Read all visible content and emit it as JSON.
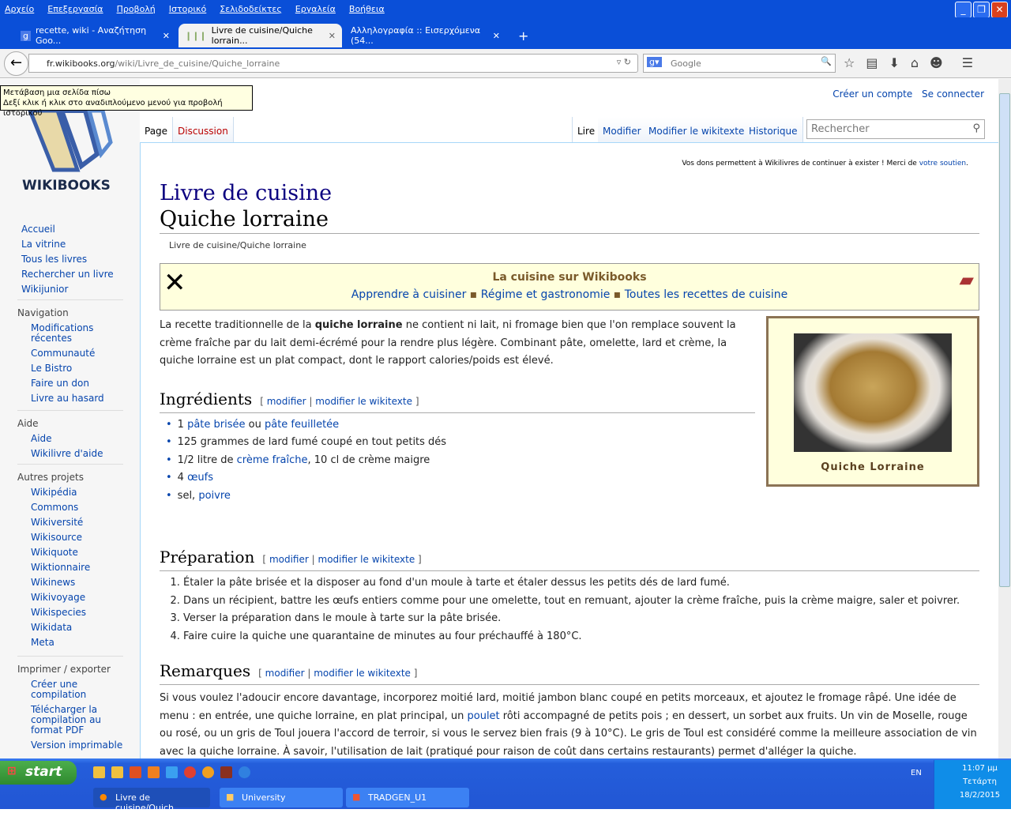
{
  "browser": {
    "menu": [
      "Αρχείο",
      "Επεξεργασία",
      "Προβολή",
      "Ιστορικό",
      "Σελιδοδείκτες",
      "Εργαλεία",
      "Βοήθεια"
    ],
    "tabs": [
      {
        "label": "recette, wiki - Αναζήτηση Goo..."
      },
      {
        "label": "Livre de cuisine/Quiche lorrain..."
      },
      {
        "label": "Αλληλογραφία :: Εισερχόμενα (54..."
      }
    ],
    "url_host": "fr.wikibooks.org",
    "url_path": "/wiki/Livre_de_cuisine/Quiche_lorraine",
    "search_placeholder": "Google",
    "tooltip_line1": "Μετάβαση μια σελίδα πίσω",
    "tooltip_line2": "Δεξί κλικ ή κλικ στο αναδιπλούμενο μενού για προβολή ιστορικού"
  },
  "wiki": {
    "logo_text": "WIKIBOOKS",
    "personal": [
      "Créer un compte",
      "Se connecter"
    ],
    "left_tabs": [
      "Page",
      "Discussion"
    ],
    "right_tabs": [
      "Lire",
      "Modifier",
      "Modifier le wikitexte",
      "Historique"
    ],
    "search_placeholder": "Rechercher",
    "notice_text": "Vos dons permettent à Wikilivres de continuer à exister ! Merci de ",
    "notice_link": "votre soutien",
    "sidebar": {
      "main": [
        "Accueil",
        "La vitrine",
        "Tous les livres",
        "Rechercher un livre",
        "Wikijunior"
      ],
      "navigation_title": "Navigation",
      "navigation": [
        "Modifications récentes",
        "Communauté",
        "Le Bistro",
        "Faire un don",
        "Livre au hasard"
      ],
      "aide_title": "Aide",
      "aide": [
        "Aide",
        "Wikilivre d'aide"
      ],
      "autres_title": "Autres projets",
      "autres": [
        "Wikipédia",
        "Commons",
        "Wikiversité",
        "Wikisource",
        "Wikiquote",
        "Wiktionnaire",
        "Wikinews",
        "Wikivoyage",
        "Wikispecies",
        "Wikidata",
        "Meta"
      ],
      "export_title": "Imprimer / exporter",
      "export": [
        "Créer une compilation",
        "Télécharger la compilation au format PDF",
        "Version imprimable"
      ]
    },
    "title_book": "Livre de cuisine",
    "title_page": "Quiche lorraine",
    "subtitle": "Livre de cuisine/Quiche lorraine",
    "banner": {
      "title": "La cuisine sur Wikibooks",
      "links": [
        "Apprendre à cuisiner",
        "Régime et gastronomie",
        "Toutes les recettes de cuisine"
      ]
    },
    "infobox_caption": "Quiche Lorraine",
    "intro_a": "La recette traditionnelle de la ",
    "intro_b": "quiche lorraine",
    "intro_c": " ne contient ni lait, ni fromage bien que l'on remplace souvent la crème fraîche par du lait demi-écrémé pour la rendre plus légère. Combinant pâte, omelette, lard et crème, la quiche lorraine est un plat compact, dont le rapport calories/poids est élevé.",
    "edit_links": {
      "open": "[",
      "modifier": "modifier",
      "sep": "|",
      "wikitexte": "modifier le wikitexte",
      "close": "]"
    },
    "ingredients_title": "Ingrédients",
    "ingredients": {
      "i1": [
        "1 ",
        "pâte brisée",
        " ou ",
        "pâte feuilletée"
      ],
      "i2": "125 grammes de lard fumé coupé en tout petits dés",
      "i3": [
        "1/2 litre de ",
        "crème fraîche",
        ", 10 cl de crème maigre"
      ],
      "i4": [
        "4 ",
        "œufs"
      ],
      "i5": [
        "sel, ",
        "poivre"
      ]
    },
    "preparation_title": "Préparation",
    "preparation": [
      "Étaler la pâte brisée et la disposer au fond d'un moule à tarte et étaler dessus les petits dés de lard fumé.",
      "Dans un récipient, battre les œufs entiers comme pour une omelette, tout en remuant, ajouter la crème fraîche, puis la crème maigre, saler et poivrer.",
      "Verser la préparation dans le moule à tarte sur la pâte brisée.",
      "Faire cuire la quiche une quarantaine de minutes au four préchauffé à 180°C."
    ],
    "remarques_title": "Remarques",
    "remarques_a": "Si vous voulez l'adoucir encore davantage, incorporez moitié lard, moitié jambon blanc coupé en petits morceaux, et ajoutez le fromage râpé. Une idée de menu : en entrée, une quiche lorraine, en plat principal, un ",
    "remarques_link": "poulet",
    "remarques_b": " rôti accompagné de petits pois ; en dessert, un sorbet aux fruits. Un vin de Moselle, rouge ou rosé, ou un gris de Toul jouera l'accord de terroir, si vous le servez bien frais (9 à 10°C). Le gris de Toul est considéré comme la meilleure association de vin avec la quiche lorraine. À savoir, l'utilisation de lait (pratiqué pour raison de coût dans certains restaurants) permet d'alléger la quiche."
  },
  "taskbar": {
    "start": "start",
    "windows": [
      "Livre de cuisine/Quich...",
      "University",
      "TRADGEN_U1"
    ],
    "lang": "EN",
    "time": "11:07 μμ",
    "day": "Τετάρτη",
    "date": "18/2/2015"
  }
}
